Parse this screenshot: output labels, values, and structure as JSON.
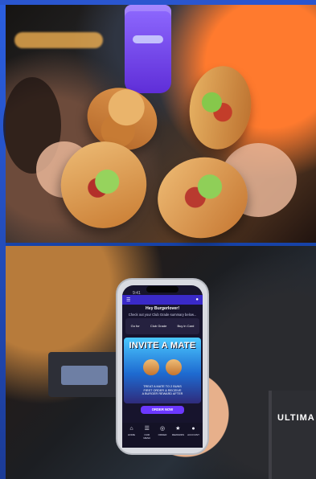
{
  "app": {
    "name": "Burger app promo collage"
  },
  "phone": {
    "status_time": "9:41",
    "greeting": "Hey Burgerlover!",
    "subtitle": "Check out your Club Grade summary below...",
    "rewards": [
      {
        "label": "Go for"
      },
      {
        "label": "Club Grade"
      },
      {
        "label": "Buy in Card"
      }
    ],
    "promo": {
      "title": "INVITE A MATE",
      "body": "TREAT A MATE TO 2 BUNS\nFIRST ORDER & RECEIVE\nA BURGER REWARD AFTER"
    },
    "cta": "ORDER NOW",
    "tabs": [
      {
        "label": "HOME",
        "icon": "home-icon"
      },
      {
        "label": "OUR MENU",
        "icon": "menu-icon"
      },
      {
        "label": "ORDER",
        "icon": "order-icon"
      },
      {
        "label": "REWARDS",
        "icon": "rewards-icon"
      },
      {
        "label": "ACCOUNT",
        "icon": "account-icon"
      }
    ]
  },
  "scene": {
    "book_text": "ULTIMA"
  }
}
